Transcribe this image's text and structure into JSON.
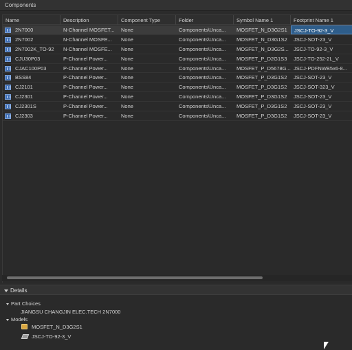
{
  "panel": {
    "title": "Components"
  },
  "table": {
    "columns": [
      "Name",
      "Description",
      "Component Type",
      "Folder",
      "Symbol Name 1",
      "Footprint Name 1"
    ],
    "rows": [
      {
        "name": "2N7000",
        "description": "N-Channel MOSFET...",
        "type": "None",
        "folder": "Components\\Unca...",
        "symbol": "MOSFET_N_D3G2S1",
        "footprint": "JSCJ-TO-92-3_V",
        "selected": true
      },
      {
        "name": "2N7002",
        "description": "N-Channel MOSFE...",
        "type": "None",
        "folder": "Components\\Unca...",
        "symbol": "MOSFET_N_D3G1S2",
        "footprint": "JSCJ-SOT-23_V",
        "selected": false
      },
      {
        "name": "2N7002K_TO-92",
        "description": "N-Channel MOSFE...",
        "type": "None",
        "folder": "Components\\Unca...",
        "symbol": "MOSFET_N_D3G2S...",
        "footprint": "JSCJ-TO-92-3_V",
        "selected": false
      },
      {
        "name": "CJU30P03",
        "description": "P-Channel Power...",
        "type": "None",
        "folder": "Components\\Unca...",
        "symbol": "MOSFET_P_D2G1S3",
        "footprint": "JSCJ-TO-252-2L_V",
        "selected": false
      },
      {
        "name": "CJAC100P03",
        "description": "P-Channel Power...",
        "type": "None",
        "folder": "Components\\Unca...",
        "symbol": "MOSFET_P_D5678G...",
        "footprint": "JSCJ-PDFNWB5x6-8...",
        "selected": false
      },
      {
        "name": "BSS84",
        "description": "P-Channel Power...",
        "type": "None",
        "folder": "Components\\Unca...",
        "symbol": "MOSFET_P_D3G1S2",
        "footprint": "JSCJ-SOT-23_V",
        "selected": false
      },
      {
        "name": "CJ2101",
        "description": "P-Channel Power...",
        "type": "None",
        "folder": "Components\\Unca...",
        "symbol": "MOSFET_P_D3G1S2",
        "footprint": "JSCJ-SOT-323_V",
        "selected": false
      },
      {
        "name": "CJ2301",
        "description": "P-Channel Power...",
        "type": "None",
        "folder": "Components\\Unca...",
        "symbol": "MOSFET_P_D3G1S2",
        "footprint": "JSCJ-SOT-23_V",
        "selected": false
      },
      {
        "name": "CJ2301S",
        "description": "P-Channel Power...",
        "type": "None",
        "folder": "Components\\Unca...",
        "symbol": "MOSFET_P_D3G1S2",
        "footprint": "JSCJ-SOT-23_V",
        "selected": false
      },
      {
        "name": "CJ2303",
        "description": "P-Channel Power...",
        "type": "None",
        "folder": "Components\\Unca...",
        "symbol": "MOSFET_P_D3G1S2",
        "footprint": "JSCJ-SOT-23_V",
        "selected": false
      }
    ]
  },
  "details": {
    "title": "Details",
    "part_choices": {
      "label": "Part Choices",
      "value": "JIANGSU CHANGJIN ELEC.TECH   2N7000"
    },
    "models": {
      "label": "Models",
      "symbol": "MOSFET_N_D3G2S1",
      "footprint": "JSCJ-TO-92-3_V"
    }
  },
  "colors": {
    "selection": "#2e5d8a",
    "component_icon": "#3f6fb5",
    "symbol_icon": "#d9a640"
  },
  "icons": {
    "component": "component-icon",
    "symbol": "schematic-symbol-icon",
    "footprint": "pcb-footprint-icon"
  }
}
